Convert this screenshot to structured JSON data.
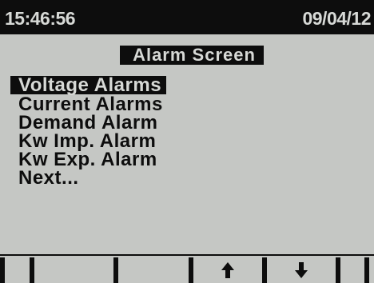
{
  "statusbar": {
    "time": "15:46:56",
    "date": "09/04/12"
  },
  "screen": {
    "title": "Alarm Screen"
  },
  "menu": {
    "items": [
      {
        "label": "Voltage Alarms",
        "selected": true
      },
      {
        "label": "Current Alarms",
        "selected": false
      },
      {
        "label": "Demand Alarm",
        "selected": false
      },
      {
        "label": "Kw Imp. Alarm",
        "selected": false
      },
      {
        "label": "Kw Exp. Alarm",
        "selected": false
      },
      {
        "label": "Next...",
        "selected": false
      }
    ]
  },
  "softkeys": [
    {
      "icon": "",
      "label": ""
    },
    {
      "icon": "",
      "label": ""
    },
    {
      "icon": "",
      "label": ""
    },
    {
      "icon": "arrow-up-icon",
      "label": ""
    },
    {
      "icon": "arrow-down-icon",
      "label": ""
    },
    {
      "icon": "",
      "label": ""
    }
  ],
  "colors": {
    "background": "#c5c7c4",
    "ink": "#0d0d0d",
    "highlight_text": "#d7d9d6"
  }
}
